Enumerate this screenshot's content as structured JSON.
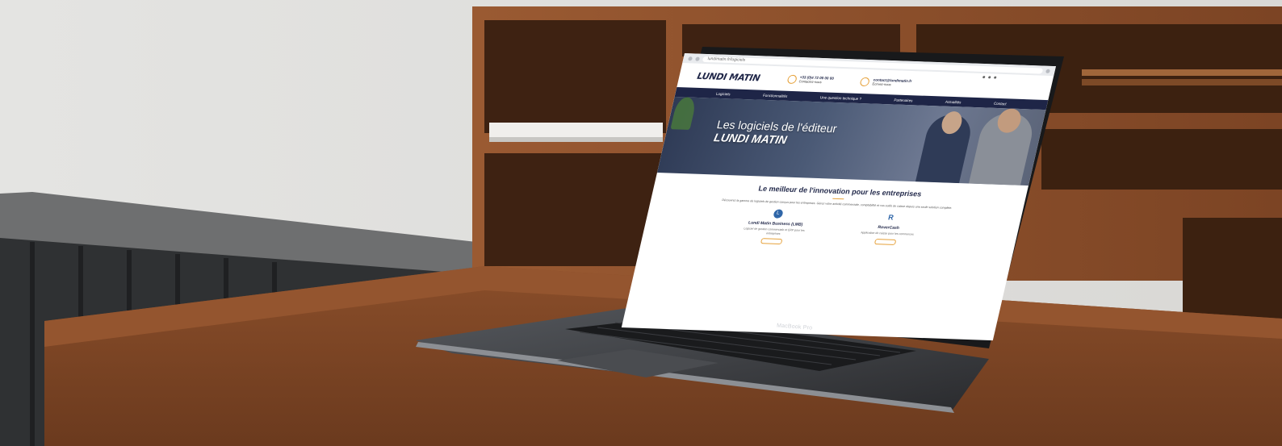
{
  "photo": {
    "description_colors": {
      "wall": "#e2e1df",
      "wood": "#8a4f2c",
      "desk": "#7a4526",
      "laptop_body": "#3a3c40"
    },
    "laptop_brand": "MacBook Pro"
  },
  "website": {
    "browser": {
      "url": "lundimatin.fr/logiciels"
    },
    "logo": "LUNDI MATIN",
    "contacts": [
      {
        "icon": "phone-icon",
        "main": "+33 (0)4 72 00 00 00",
        "sub": "Contactez-nous"
      },
      {
        "icon": "mail-icon",
        "main": "contact@lundimatin.fr",
        "sub": "Écrivez-nous"
      }
    ],
    "nav": [
      "Logiciels",
      "Fonctionnalités",
      "Une question technique ?",
      "Partenaires",
      "Actualités",
      "Contact"
    ],
    "hero": {
      "line1": "Les logiciels de l'éditeur",
      "line2": "LUNDI MATIN"
    },
    "section": {
      "title": "Le meilleur de l'innovation pour les entreprises",
      "text": "Découvrez la gamme de logiciels de gestion conçus pour les entreprises. Gérez votre activité commerciale, comptabilité et vos outils de caisse depuis une seule solution complète."
    },
    "products": [
      {
        "icon": "lmb-icon",
        "glyph": "L",
        "name": "Lundi Matin Business (LMB)",
        "desc": "Logiciel de gestion commerciale et ERP pour les entreprises"
      },
      {
        "icon": "rovercash-icon",
        "glyph": "R",
        "name": "RoverCash",
        "desc": "Application de caisse pour les commerces"
      }
    ]
  }
}
